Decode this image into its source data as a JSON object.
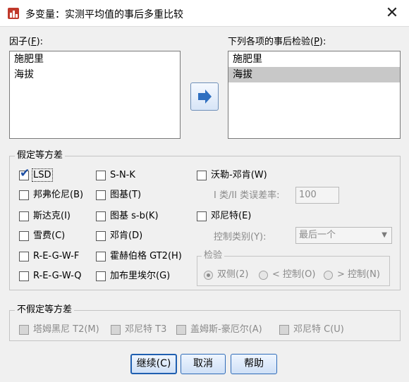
{
  "window": {
    "title": "多变量：实测平均值的事后多重比较"
  },
  "factors": {
    "label": "因子(F):",
    "items": [
      "施肥里",
      "海拔"
    ]
  },
  "posthoc": {
    "label": "下列各项的事后检验(P):",
    "items": [
      "施肥里",
      "海拔"
    ],
    "selected_index": 1
  },
  "equal_var": {
    "legend": "假定等方差",
    "options": {
      "lsd": {
        "label": "LSD",
        "checked": true
      },
      "bonferroni": {
        "label": "邦弗伦尼(B)",
        "checked": false
      },
      "sidak": {
        "label": "斯达克(I)",
        "checked": false
      },
      "scheffe": {
        "label": "雪费(C)",
        "checked": false
      },
      "regwf": {
        "label": "R-E-G-W-F",
        "checked": false
      },
      "regwq": {
        "label": "R-E-G-W-Q",
        "checked": false
      },
      "snk": {
        "label": "S-N-K",
        "checked": false
      },
      "tukey": {
        "label": "图基(T)",
        "checked": false
      },
      "tukeyb": {
        "label": "图基 s-b(K)",
        "checked": false
      },
      "duncan": {
        "label": "邓肯(D)",
        "checked": false
      },
      "hochberg": {
        "label": "霍赫伯格 GT2(H)",
        "checked": false
      },
      "gabriel": {
        "label": "加布里埃尔(G)",
        "checked": false
      },
      "waller": {
        "label": "沃勒-邓肯(W)",
        "checked": false
      },
      "dunnett": {
        "label": "邓尼特(E)",
        "checked": false
      }
    },
    "error_ratio_label": "I 类/II 类误差率:",
    "error_ratio_value": "100",
    "control_label": "控制类别(Y):",
    "control_value": "最后一个",
    "test": {
      "legend": "检验",
      "two_sided": "双侧(2)",
      "less": "< 控制(O)",
      "greater": "> 控制(N)",
      "selected": "two_sided"
    }
  },
  "unequal_var": {
    "legend": "不假定等方差",
    "options": {
      "tamhane": "塔姆黑尼 T2(M)",
      "dunnett_t3": "邓尼特 T3",
      "games_howell": "盖姆斯-豪厄尔(A)",
      "dunnett_c": "邓尼特 C(U)"
    }
  },
  "buttons": {
    "continue": "继续(C)",
    "cancel": "取消",
    "help": "帮助"
  },
  "colors": {
    "accent": "#1f5fb0",
    "selection": "#c8c8c8",
    "move_arrow": "#2f6fc0"
  }
}
